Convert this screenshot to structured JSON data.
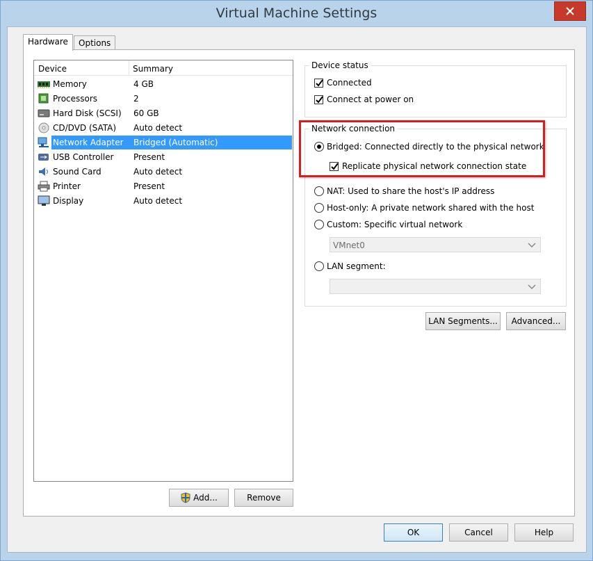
{
  "window": {
    "title": "Virtual Machine Settings"
  },
  "tabs": [
    {
      "label": "Hardware",
      "active": true
    },
    {
      "label": "Options",
      "active": false
    }
  ],
  "device_list": {
    "columns": [
      "Device",
      "Summary"
    ],
    "rows": [
      {
        "icon": "memory-icon",
        "device": "Memory",
        "summary": "4 GB"
      },
      {
        "icon": "processor-icon",
        "device": "Processors",
        "summary": "2"
      },
      {
        "icon": "hard-disk-icon",
        "device": "Hard Disk (SCSI)",
        "summary": "60 GB"
      },
      {
        "icon": "cd-dvd-icon",
        "device": "CD/DVD (SATA)",
        "summary": "Auto detect"
      },
      {
        "icon": "network-adapter-icon",
        "device": "Network Adapter",
        "summary": "Bridged (Automatic)",
        "selected": true
      },
      {
        "icon": "usb-icon",
        "device": "USB Controller",
        "summary": "Present"
      },
      {
        "icon": "sound-card-icon",
        "device": "Sound Card",
        "summary": "Auto detect"
      },
      {
        "icon": "printer-icon",
        "device": "Printer",
        "summary": "Present"
      },
      {
        "icon": "display-icon",
        "device": "Display",
        "summary": "Auto detect"
      }
    ]
  },
  "list_buttons": {
    "add": "Add...",
    "remove": "Remove"
  },
  "device_status": {
    "title": "Device status",
    "connected": {
      "label": "Connected",
      "checked": true
    },
    "connect_at_power_on": {
      "label": "Connect at power on",
      "checked": true
    }
  },
  "network_connection": {
    "title": "Network connection",
    "bridged": {
      "label": "Bridged: Connected directly to the physical network",
      "selected": true
    },
    "replicate": {
      "label": "Replicate physical network connection state",
      "checked": true
    },
    "nat": {
      "label": "NAT: Used to share the host's IP address",
      "selected": false
    },
    "host_only": {
      "label": "Host-only: A private network shared with the host",
      "selected": false
    },
    "custom": {
      "label": "Custom: Specific virtual network",
      "selected": false,
      "select_value": "VMnet0"
    },
    "lan_segment": {
      "label": "LAN segment:",
      "selected": false,
      "select_value": ""
    }
  },
  "network_buttons": {
    "lan_segments": "LAN Segments...",
    "advanced": "Advanced..."
  },
  "dialog_buttons": {
    "ok": "OK",
    "cancel": "Cancel",
    "help": "Help"
  },
  "colors": {
    "selection": "#3399ff",
    "highlight": "#d21f1f",
    "close": "#c7392b"
  }
}
